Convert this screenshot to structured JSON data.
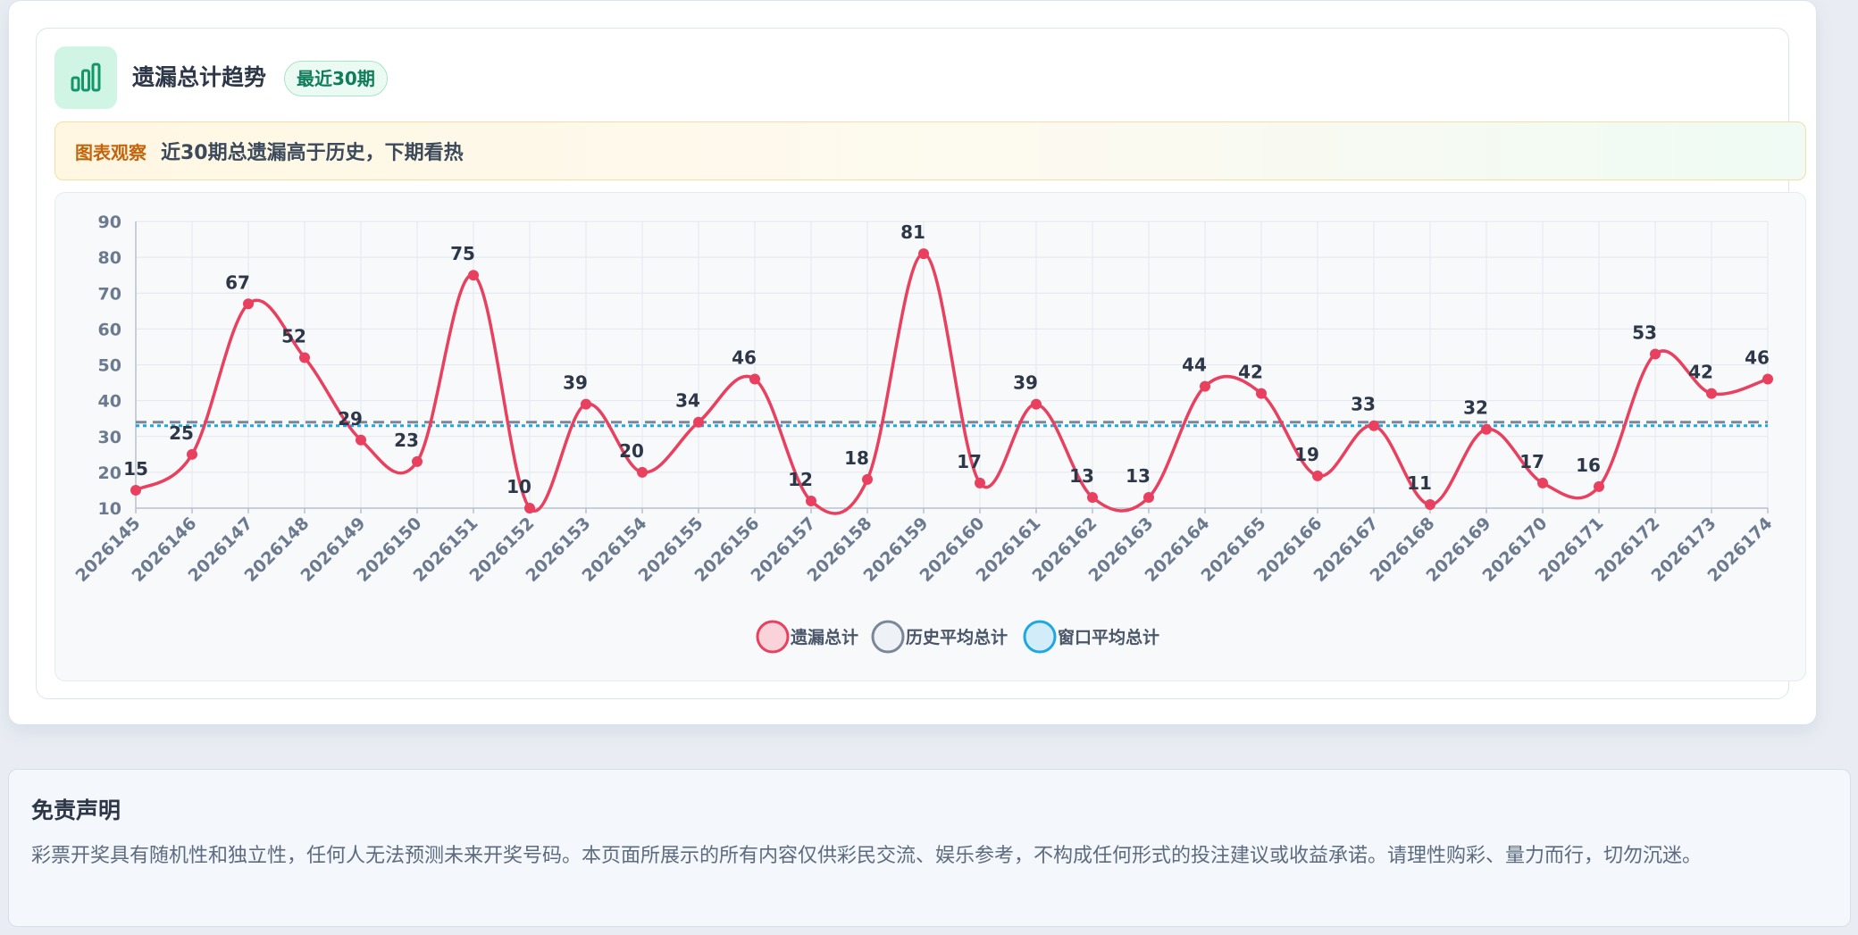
{
  "card": {
    "title": "遗漏总计趋势",
    "badge": "最近30期",
    "icon": "bar-chart-icon",
    "observation_label": "图表观察",
    "observation_text": "近30期总遗漏高于历史，下期看热"
  },
  "chart_data": {
    "type": "line",
    "categories": [
      "2026145",
      "2026146",
      "2026147",
      "2026148",
      "2026149",
      "2026150",
      "2026151",
      "2026152",
      "2026153",
      "2026154",
      "2026155",
      "2026156",
      "2026157",
      "2026158",
      "2026159",
      "2026160",
      "2026161",
      "2026162",
      "2026163",
      "2026164",
      "2026165",
      "2026166",
      "2026167",
      "2026168",
      "2026169",
      "2026170",
      "2026171",
      "2026172",
      "2026173",
      "2026174"
    ],
    "series": [
      {
        "name": "遗漏总计",
        "values": [
          15,
          25,
          67,
          52,
          29,
          23,
          75,
          10,
          39,
          20,
          34,
          46,
          12,
          18,
          81,
          17,
          39,
          13,
          13,
          44,
          42,
          19,
          33,
          11,
          32,
          17,
          16,
          53,
          42,
          46
        ],
        "color": "#e8405e",
        "style": "smooth-line-with-labels"
      },
      {
        "name": "历史平均总计",
        "values": [
          34,
          34,
          34,
          34,
          34,
          34,
          34,
          34,
          34,
          34,
          34,
          34,
          34,
          34,
          34,
          34,
          34,
          34,
          34,
          34,
          34,
          34,
          34,
          34,
          34,
          34,
          34,
          34,
          34,
          34
        ],
        "color": "#7b8799",
        "style": "dashed"
      },
      {
        "name": "窗口平均总计",
        "values": [
          33,
          33,
          33,
          33,
          33,
          33,
          33,
          33,
          33,
          33,
          33,
          33,
          33,
          33,
          33,
          33,
          33,
          33,
          33,
          33,
          33,
          33,
          33,
          33,
          33,
          33,
          33,
          33,
          33,
          33
        ],
        "color": "#1ea7e0",
        "style": "dotted"
      }
    ],
    "yticks": [
      10,
      20,
      30,
      40,
      50,
      60,
      70,
      80,
      90
    ],
    "ylim": [
      10,
      90
    ],
    "grid": true,
    "legend": "bottom-center",
    "xlabel": "",
    "ylabel": ""
  },
  "disclaimer": {
    "title": "免责声明",
    "text": "彩票开奖具有随机性和独立性，任何人无法预测未来开奖号码。本页面所展示的所有内容仅供彩民交流、娱乐参考，不构成任何形式的投注建议或收益承诺。请理性购彩、量力而行，切勿沉迷。"
  }
}
